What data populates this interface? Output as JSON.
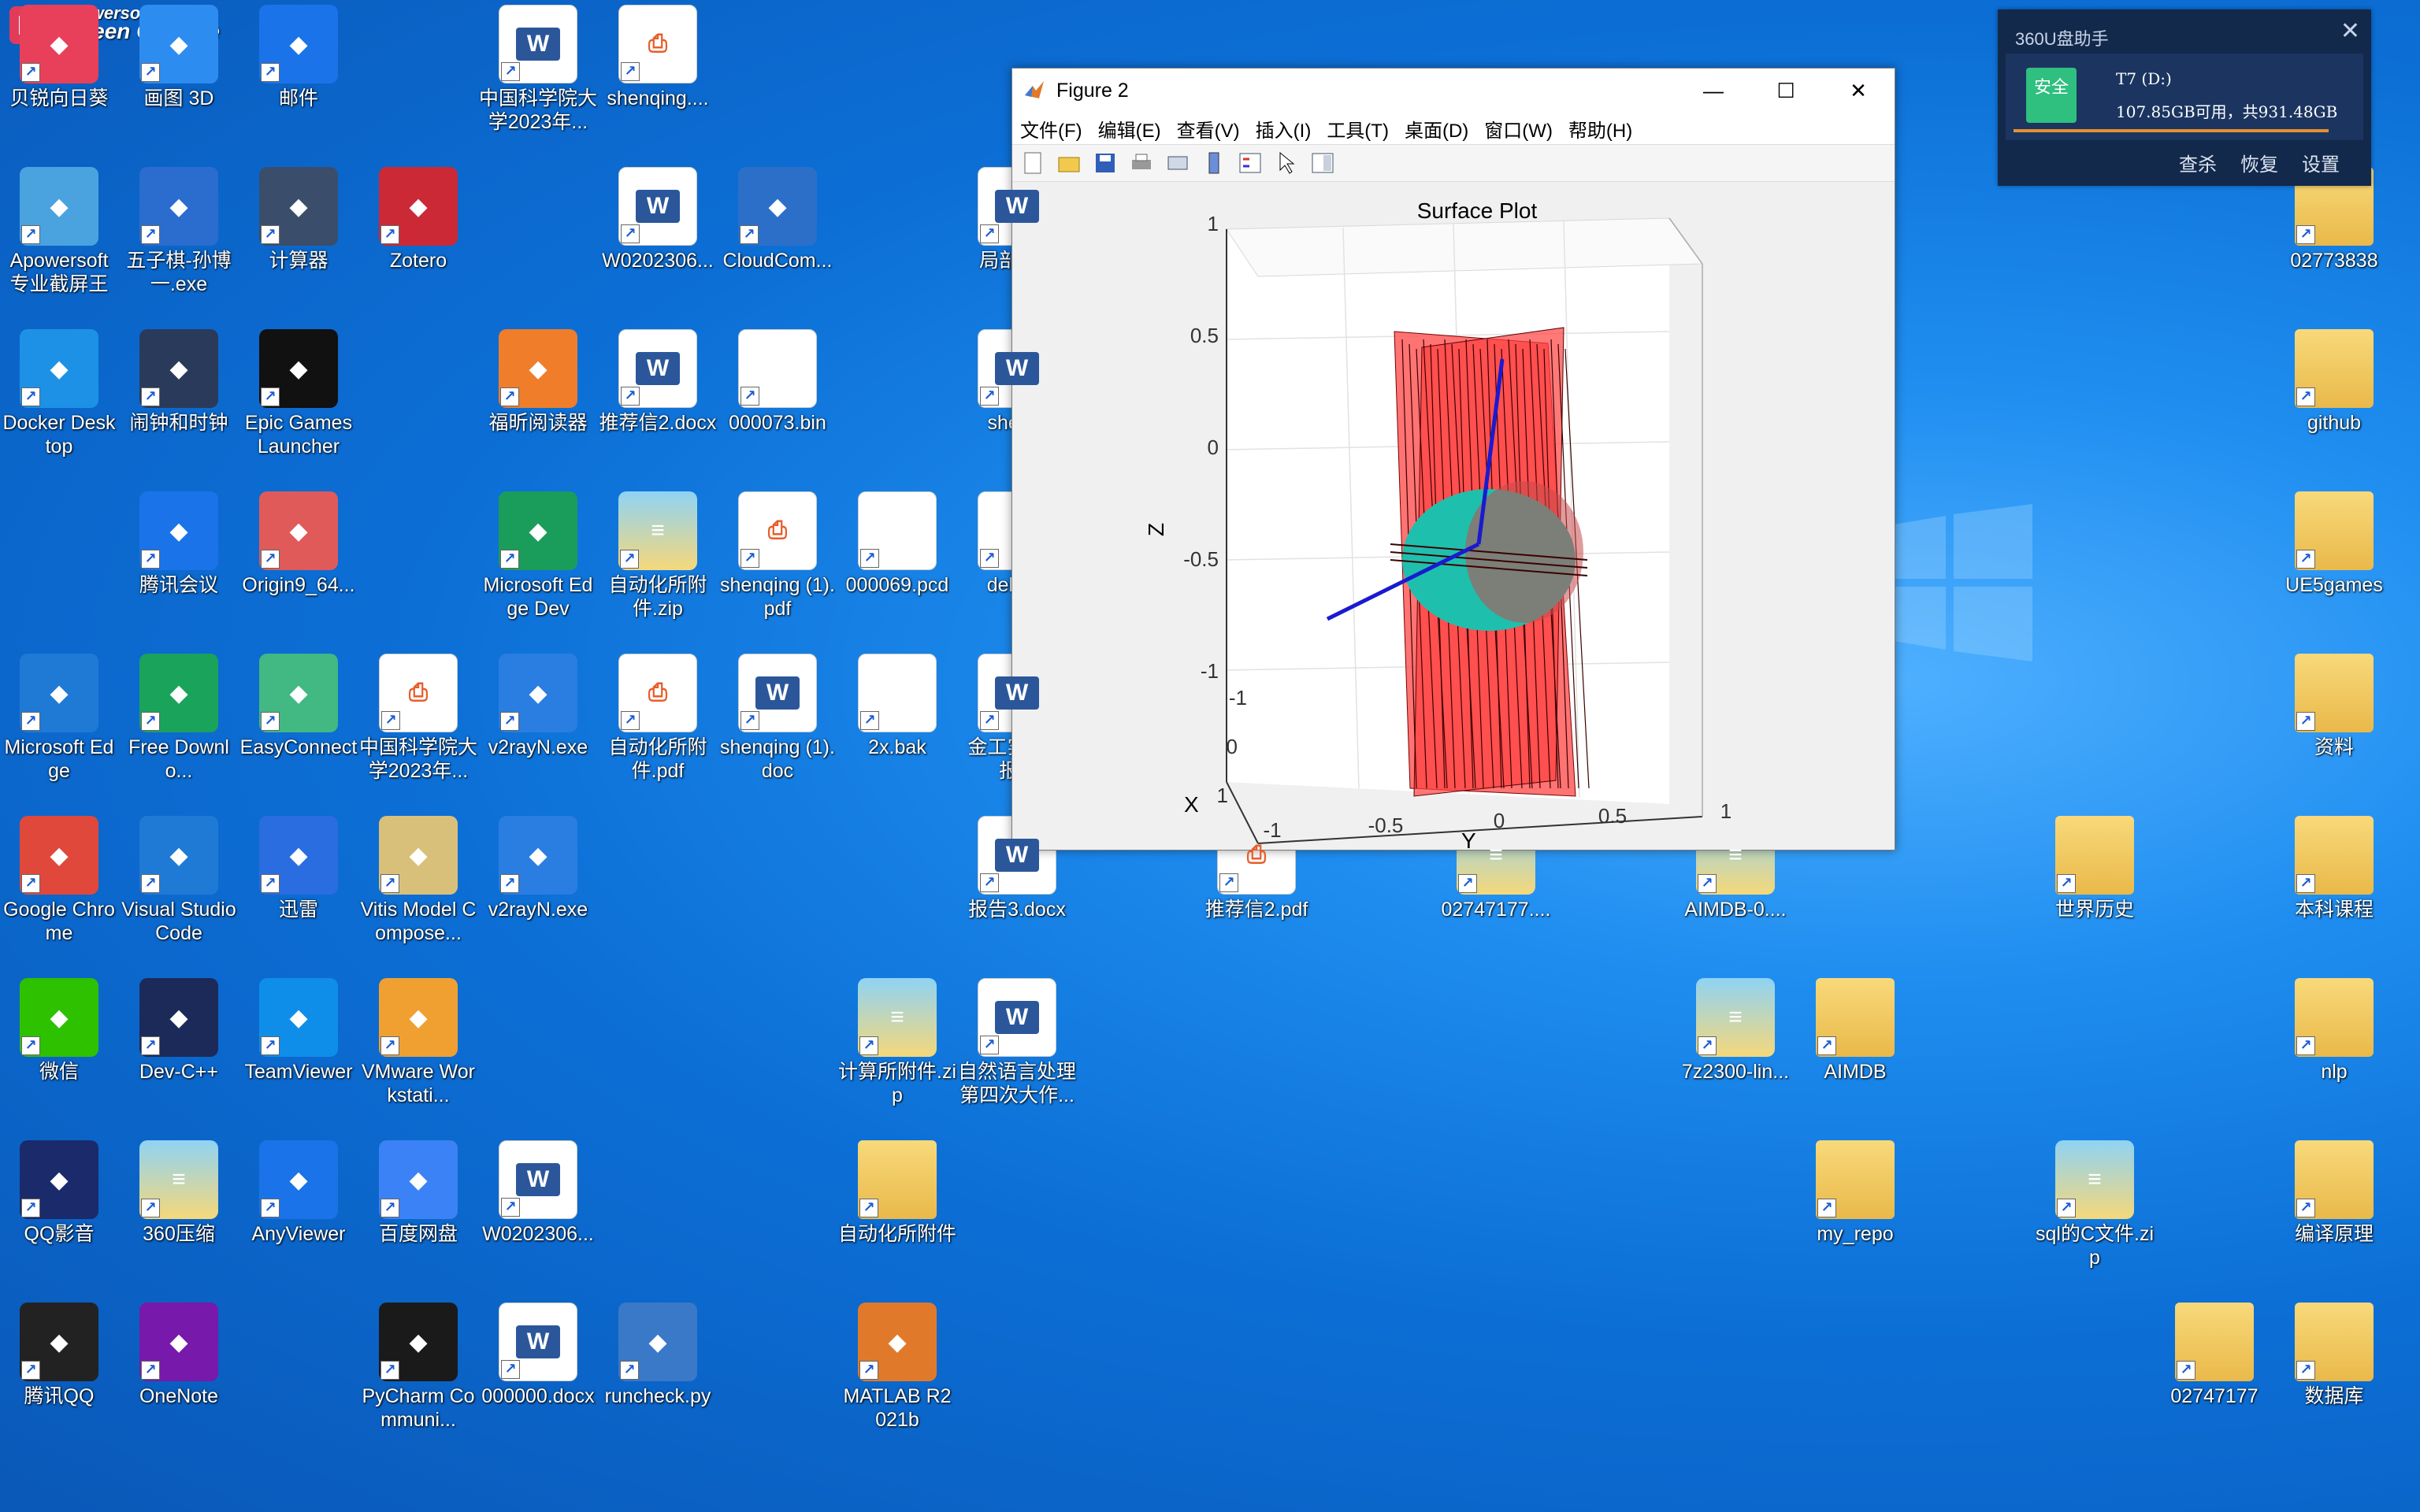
{
  "watermark": {
    "line1": "Apowersoft",
    "line2": "Screen Capture Pro"
  },
  "desktop_icons": [
    {
      "label": "贝锐向日葵",
      "icon": "sunlogin-icon"
    },
    {
      "label": "画图 3D",
      "icon": "paint3d-icon"
    },
    {
      "label": "邮件",
      "icon": "mail-icon"
    },
    {
      "label": "中国科学院大学2023年...",
      "icon": "word-icon"
    },
    {
      "label": "shenqing....",
      "icon": "pdf-icon"
    },
    {
      "label": "Apowersoft专业截屏王",
      "icon": "apowersoft-icon"
    },
    {
      "label": "五子棋-孙博一.exe",
      "icon": "exe-icon"
    },
    {
      "label": "计算器",
      "icon": "calculator-icon"
    },
    {
      "label": "Zotero",
      "icon": "zotero-icon"
    },
    {
      "label": "W0202306...",
      "icon": "word-icon"
    },
    {
      "label": "CloudCom...",
      "icon": "cloudcompare-icon"
    },
    {
      "label": "局部化...",
      "icon": "word-icon"
    },
    {
      "label": "Docker Desktop",
      "icon": "docker-icon"
    },
    {
      "label": "闹钟和时钟",
      "icon": "clock-icon"
    },
    {
      "label": "Epic Games Launcher",
      "icon": "epic-icon"
    },
    {
      "label": "福昕阅读器",
      "icon": "foxit-icon"
    },
    {
      "label": "推荐信2.docx",
      "icon": "word-icon"
    },
    {
      "label": "000073.bin",
      "icon": "file-icon"
    },
    {
      "label": "shen...",
      "icon": "word-icon"
    },
    {
      "label": "腾讯会议",
      "icon": "tencent-meeting-icon"
    },
    {
      "label": "Origin9_64...",
      "icon": "origin-icon"
    },
    {
      "label": "Microsoft Edge Dev",
      "icon": "edge-dev-icon"
    },
    {
      "label": "自动化所附件.zip",
      "icon": "zip-icon"
    },
    {
      "label": "shenqing (1).pdf",
      "icon": "pdf-icon"
    },
    {
      "label": "000069.pcd",
      "icon": "file-icon"
    },
    {
      "label": "debu...",
      "icon": "file-icon"
    },
    {
      "label": "Microsoft Edge",
      "icon": "edge-icon"
    },
    {
      "label": "Free Downlo...",
      "icon": "fdm-icon"
    },
    {
      "label": "EasyConnect",
      "icon": "easyconnect-icon"
    },
    {
      "label": "中国科学院大学2023年...",
      "icon": "pdf-icon"
    },
    {
      "label": "v2rayN.exe",
      "icon": "v2ray-icon"
    },
    {
      "label": "自动化所附件.pdf",
      "icon": "pdf-icon"
    },
    {
      "label": "shenqing (1).doc",
      "icon": "word-icon"
    },
    {
      "label": "2x.bak",
      "icon": "file-icon"
    },
    {
      "label": "金工实设计报...",
      "icon": "word-icon"
    },
    {
      "label": "Google Chrome",
      "icon": "chrome-icon"
    },
    {
      "label": "Visual Studio Code",
      "icon": "vscode-icon"
    },
    {
      "label": "迅雷",
      "icon": "thunder-icon"
    },
    {
      "label": "Vitis Model Compose...",
      "icon": "vitis-icon"
    },
    {
      "label": "v2rayN.exe",
      "icon": "v2ray-icon"
    },
    {
      "label": "报告3.docx",
      "icon": "word-icon"
    },
    {
      "label": "推荐信2.pdf",
      "icon": "pdf-icon"
    },
    {
      "label": "02747177....",
      "icon": "zip-icon"
    },
    {
      "label": "AIMDB-0....",
      "icon": "zip-icon"
    },
    {
      "label": "世界历史",
      "icon": "folder-icon"
    },
    {
      "label": "微信",
      "icon": "wechat-icon"
    },
    {
      "label": "Dev-C++",
      "icon": "devcpp-icon"
    },
    {
      "label": "TeamViewer",
      "icon": "teamviewer-icon"
    },
    {
      "label": "VMware Workstati...",
      "icon": "vmware-icon"
    },
    {
      "label": "计算所附件.zip",
      "icon": "zip-icon"
    },
    {
      "label": "自然语言处理第四次大作...",
      "icon": "word-icon"
    },
    {
      "label": "7z2300-lin...",
      "icon": "zip-icon"
    },
    {
      "label": "AIMDB",
      "icon": "folder-icon"
    },
    {
      "label": "QQ影音",
      "icon": "qqplayer-icon"
    },
    {
      "label": "360压缩",
      "icon": "zip-icon"
    },
    {
      "label": "AnyViewer",
      "icon": "anyviewer-icon"
    },
    {
      "label": "百度网盘",
      "icon": "baidu-netdisk-icon"
    },
    {
      "label": "W0202306...",
      "icon": "word-icon"
    },
    {
      "label": "自动化所附件",
      "icon": "folder-icon"
    },
    {
      "label": "my_repo",
      "icon": "folder-icon"
    },
    {
      "label": "sql的C文件.zip",
      "icon": "zip-icon"
    },
    {
      "label": "腾讯QQ",
      "icon": "qq-icon"
    },
    {
      "label": "OneNote",
      "icon": "onenote-icon"
    },
    {
      "label": "PyCharm Communi...",
      "icon": "pycharm-icon"
    },
    {
      "label": "000000.docx",
      "icon": "word-icon"
    },
    {
      "label": "runcheck.py",
      "icon": "python-icon"
    },
    {
      "label": "MATLAB R2021b",
      "icon": "matlab-icon"
    },
    {
      "label": "02773838",
      "icon": "folder-icon"
    },
    {
      "label": "github",
      "icon": "folder-icon"
    },
    {
      "label": "UE5games",
      "icon": "folder-icon"
    },
    {
      "label": "资料",
      "icon": "folder-icon"
    },
    {
      "label": "本科课程",
      "icon": "folder-icon"
    },
    {
      "label": "nlp",
      "icon": "folder-icon"
    },
    {
      "label": "编译原理",
      "icon": "folder-icon"
    },
    {
      "label": "02747177",
      "icon": "folder-icon"
    },
    {
      "label": "数据库",
      "icon": "folder-icon"
    }
  ],
  "figure_window": {
    "title": "Figure 2",
    "menu": [
      "文件(F)",
      "编辑(E)",
      "查看(V)",
      "插入(I)",
      "工具(T)",
      "桌面(D)",
      "窗口(W)",
      "帮助(H)"
    ],
    "toolbar": [
      "new-figure-icon",
      "open-icon",
      "save-icon",
      "print-icon",
      "link-icon",
      "colorbar-icon",
      "legend-icon",
      "pointer-icon",
      "property-icon"
    ],
    "controls": {
      "minimize": "—",
      "maximize": "☐",
      "close": "✕"
    }
  },
  "chart_data": {
    "type": "surface",
    "title": "Surface Plot",
    "xlabel": "X",
    "ylabel": "Y",
    "zlabel": "Z",
    "zticks": [
      "1",
      "0.5",
      "0",
      "-0.5",
      "-1"
    ],
    "yticks": [
      "-1",
      "-0.5",
      "0",
      "0.5",
      "1"
    ],
    "xticks": [
      "-1",
      "0",
      "1"
    ],
    "zlim": [
      -1,
      1
    ],
    "ylim": [
      -1,
      1
    ],
    "xlim": [
      -1,
      1
    ],
    "surface_color": "#ff5a5a",
    "disk_color": "#1fbfae",
    "axis_line_color": "#1a1ad0"
  },
  "widget_360": {
    "title": "360U盘助手",
    "badge": "安全",
    "drive": "T7 (D:)",
    "space": "107.85GB可用，共931.48GB",
    "actions": [
      "查杀",
      "恢复",
      "设置"
    ]
  }
}
